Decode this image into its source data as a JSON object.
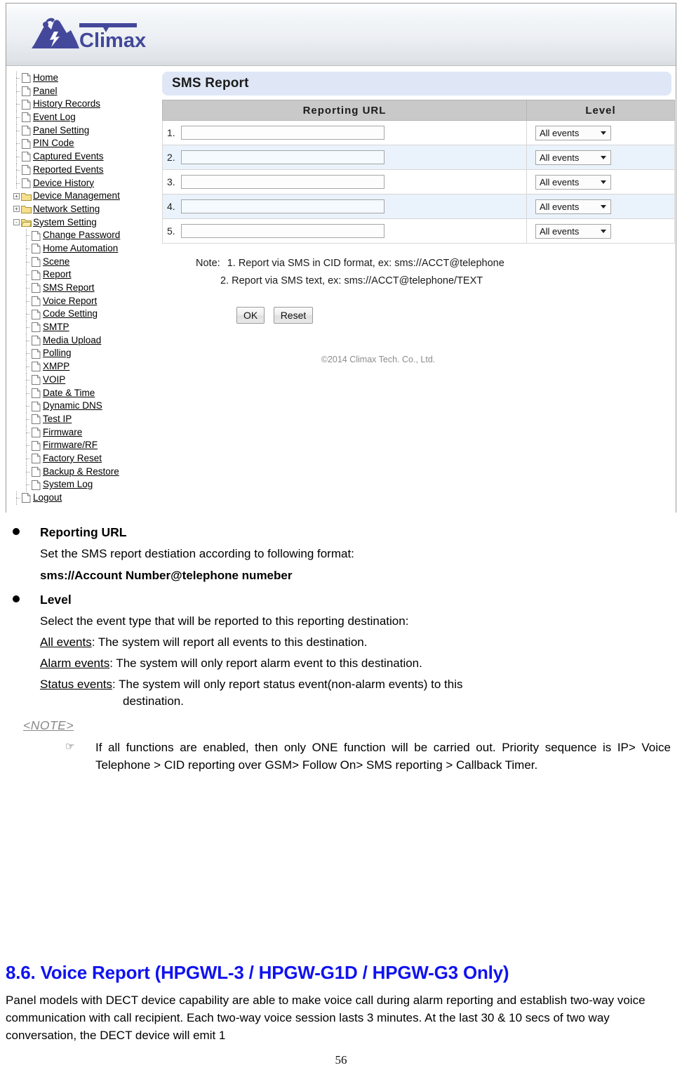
{
  "browser_shot": {
    "logo": {
      "brand": "Climax",
      "icon": "climax-mountain-logo"
    },
    "sidebar": {
      "items": [
        {
          "label": "Home",
          "type": "page",
          "level": 0,
          "expander": ""
        },
        {
          "label": "Panel",
          "type": "page",
          "level": 0,
          "expander": ""
        },
        {
          "label": "History Records",
          "type": "page",
          "level": 0,
          "expander": ""
        },
        {
          "label": "Event Log",
          "type": "page",
          "level": 0,
          "expander": ""
        },
        {
          "label": "Panel Setting",
          "type": "page",
          "level": 0,
          "expander": ""
        },
        {
          "label": "PIN Code",
          "type": "page",
          "level": 0,
          "expander": ""
        },
        {
          "label": "Captured Events",
          "type": "page",
          "level": 0,
          "expander": ""
        },
        {
          "label": "Reported Events",
          "type": "page",
          "level": 0,
          "expander": ""
        },
        {
          "label": "Device History",
          "type": "page",
          "level": 0,
          "expander": ""
        },
        {
          "label": "Device Management",
          "type": "folder",
          "level": 0,
          "expander": "+"
        },
        {
          "label": "Network Setting",
          "type": "folder",
          "level": 0,
          "expander": "+"
        },
        {
          "label": "System Setting",
          "type": "folder-open",
          "level": 0,
          "expander": "-"
        },
        {
          "label": "Change Password",
          "type": "page",
          "level": 1,
          "expander": ""
        },
        {
          "label": "Home Automation",
          "type": "page",
          "level": 1,
          "expander": ""
        },
        {
          "label": "Scene",
          "type": "page",
          "level": 1,
          "expander": ""
        },
        {
          "label": "Report",
          "type": "page",
          "level": 1,
          "expander": ""
        },
        {
          "label": "SMS Report",
          "type": "page",
          "level": 1,
          "expander": ""
        },
        {
          "label": "Voice Report",
          "type": "page",
          "level": 1,
          "expander": ""
        },
        {
          "label": "Code Setting",
          "type": "page",
          "level": 1,
          "expander": ""
        },
        {
          "label": "SMTP",
          "type": "page",
          "level": 1,
          "expander": ""
        },
        {
          "label": "Media Upload",
          "type": "page",
          "level": 1,
          "expander": ""
        },
        {
          "label": "Polling",
          "type": "page",
          "level": 1,
          "expander": ""
        },
        {
          "label": "XMPP",
          "type": "page",
          "level": 1,
          "expander": ""
        },
        {
          "label": "VOIP",
          "type": "page",
          "level": 1,
          "expander": ""
        },
        {
          "label": "Date & Time",
          "type": "page",
          "level": 1,
          "expander": ""
        },
        {
          "label": "Dynamic DNS",
          "type": "page",
          "level": 1,
          "expander": ""
        },
        {
          "label": "Test IP",
          "type": "page",
          "level": 1,
          "expander": ""
        },
        {
          "label": "Firmware",
          "type": "page",
          "level": 1,
          "expander": ""
        },
        {
          "label": "Firmware/RF",
          "type": "page",
          "level": 1,
          "expander": ""
        },
        {
          "label": "Factory Reset",
          "type": "page",
          "level": 1,
          "expander": ""
        },
        {
          "label": "Backup & Restore",
          "type": "page",
          "level": 1,
          "expander": ""
        },
        {
          "label": "System Log",
          "type": "page",
          "level": 1,
          "expander": ""
        },
        {
          "label": "Logout",
          "type": "page",
          "level": 0,
          "expander": ""
        }
      ]
    },
    "panel": {
      "title": "SMS Report",
      "table": {
        "headers": [
          "Reporting URL",
          "Level"
        ],
        "rows": [
          {
            "num": "1.",
            "url": "",
            "level": "All events"
          },
          {
            "num": "2.",
            "url": "",
            "level": "All events"
          },
          {
            "num": "3.",
            "url": "",
            "level": "All events"
          },
          {
            "num": "4.",
            "url": "",
            "level": "All events"
          },
          {
            "num": "5.",
            "url": "",
            "level": "All events"
          }
        ],
        "level_options": [
          "All events",
          "Alarm events",
          "Status events"
        ]
      },
      "note_label": "Note:",
      "note_1": "1. Report via SMS in CID format, ex: sms://ACCT@telephone",
      "note_2": "2. Report via SMS text, ex: sms://ACCT@telephone/TEXT",
      "ok_label": "OK",
      "reset_label": "Reset",
      "copyright": "©2014 Climax Tech. Co., Ltd."
    }
  },
  "document": {
    "bullet1_title": "Reporting URL",
    "bullet1_line1": "Set the SMS report destiation according to following format:",
    "bullet1_line2": "sms://Account Number@telephone numeber",
    "bullet2_title": "Level",
    "bullet2_line1": "Select the event type that will be reported to this reporting destination:",
    "level_all_term": "All events",
    "level_all_desc": ": The system will report all events to this destination.",
    "level_alarm_term": "Alarm events",
    "level_alarm_desc": ": The system will only report alarm event to this destination.",
    "level_status_term": "Status events",
    "level_status_desc": ": The system will only report status event(non-alarm events) to this",
    "level_status_desc2": "destination.",
    "note_tag": "<NOTE>",
    "note_hand_icon": "pointing-hand-icon",
    "note_body": "If all functions are enabled, then only ONE function will be carried out. Priority sequence is IP> Voice Telephone > CID reporting over GSM> Follow On> SMS reporting > Callback Timer.",
    "section_heading": "8.6. Voice Report (HPGWL-3 / HPGW-G1D / HPGW-G3 Only)",
    "section_body": "Panel models with DECT device capability are able to make voice call during alarm reporting and establish two-way voice communication with call recipient. Each two-way voice session lasts 3 minutes. At the last 30 & 10 secs of two way conversation, the DECT device will emit 1",
    "page_number": "56"
  }
}
